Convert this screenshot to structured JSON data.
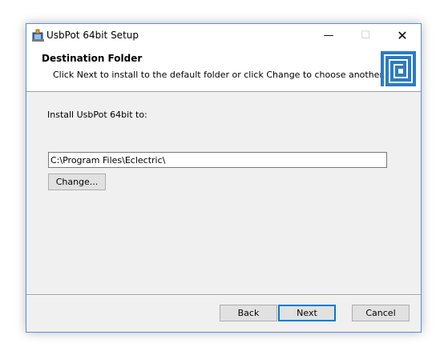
{
  "window": {
    "title": "UsbPot 64bit Setup",
    "controls": {
      "minimize": "—",
      "maximize": "☐",
      "close": "✕"
    }
  },
  "header": {
    "title": "Destination Folder",
    "subtitle": "Click Next to install to the default folder or click Change to choose another."
  },
  "body": {
    "install_label": "Install UsbPot 64bit to:",
    "path_value": "C:\\Program Files\\Eclectric\\",
    "change_label": "Change..."
  },
  "footer": {
    "back_label": "Back",
    "next_label": "Next",
    "cancel_label": "Cancel"
  },
  "colors": {
    "logo": "#2b7bc4",
    "accent": "#0078d7"
  }
}
